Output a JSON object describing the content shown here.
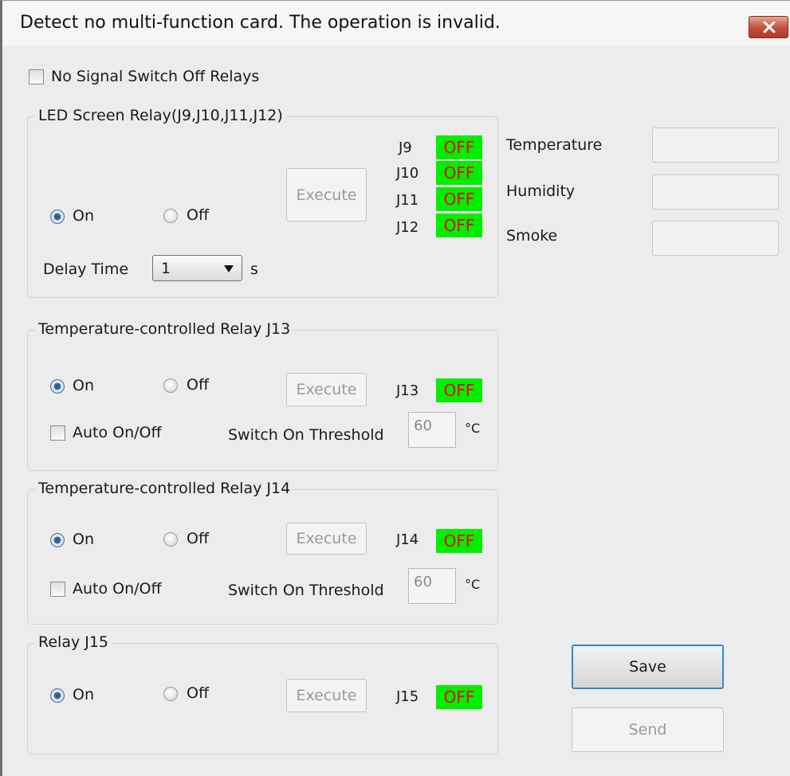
{
  "window": {
    "title": "Detect no multi-function card. The operation is invalid.",
    "close_icon": "close-icon"
  },
  "no_signal_switch_off_relays": {
    "label": "No Signal Switch Off Relays",
    "checked": false
  },
  "led_screen_relay": {
    "title": "LED Screen Relay(J9,J10,J11,J12)",
    "on_label": "On",
    "off_label": "Off",
    "selected": "On",
    "execute_label": "Execute",
    "relays": [
      {
        "id": "J9",
        "status": "OFF"
      },
      {
        "id": "J10",
        "status": "OFF"
      },
      {
        "id": "J11",
        "status": "OFF"
      },
      {
        "id": "J12",
        "status": "OFF"
      }
    ],
    "delay_time_label": "Delay Time",
    "delay_time_value": "1",
    "delay_time_unit": "s"
  },
  "sensors": {
    "temperature_label": "Temperature",
    "temperature_value": "",
    "humidity_label": "Humidity",
    "humidity_value": "",
    "smoke_label": "Smoke",
    "smoke_value": ""
  },
  "relay_j13": {
    "title": "Temperature-controlled Relay J13",
    "on_label": "On",
    "off_label": "Off",
    "selected": "On",
    "execute_label": "Execute",
    "relay_id": "J13",
    "status": "OFF",
    "auto_label": "Auto On/Off",
    "auto_checked": false,
    "threshold_label": "Switch On Threshold",
    "threshold_value": "60",
    "threshold_unit": "°C"
  },
  "relay_j14": {
    "title": "Temperature-controlled Relay J14",
    "on_label": "On",
    "off_label": "Off",
    "selected": "On",
    "execute_label": "Execute",
    "relay_id": "J14",
    "status": "OFF",
    "auto_label": "Auto On/Off",
    "auto_checked": false,
    "threshold_label": "Switch On Threshold",
    "threshold_value": "60",
    "threshold_unit": "°C"
  },
  "relay_j15": {
    "title": "Relay J15",
    "on_label": "On",
    "off_label": "Off",
    "selected": "On",
    "execute_label": "Execute",
    "relay_id": "J15",
    "status": "OFF"
  },
  "buttons": {
    "save_label": "Save",
    "send_label": "Send"
  },
  "colors": {
    "status_on_bg": "#00ee00",
    "status_text": "#f00000",
    "focus_border": "#2e8bcb"
  }
}
